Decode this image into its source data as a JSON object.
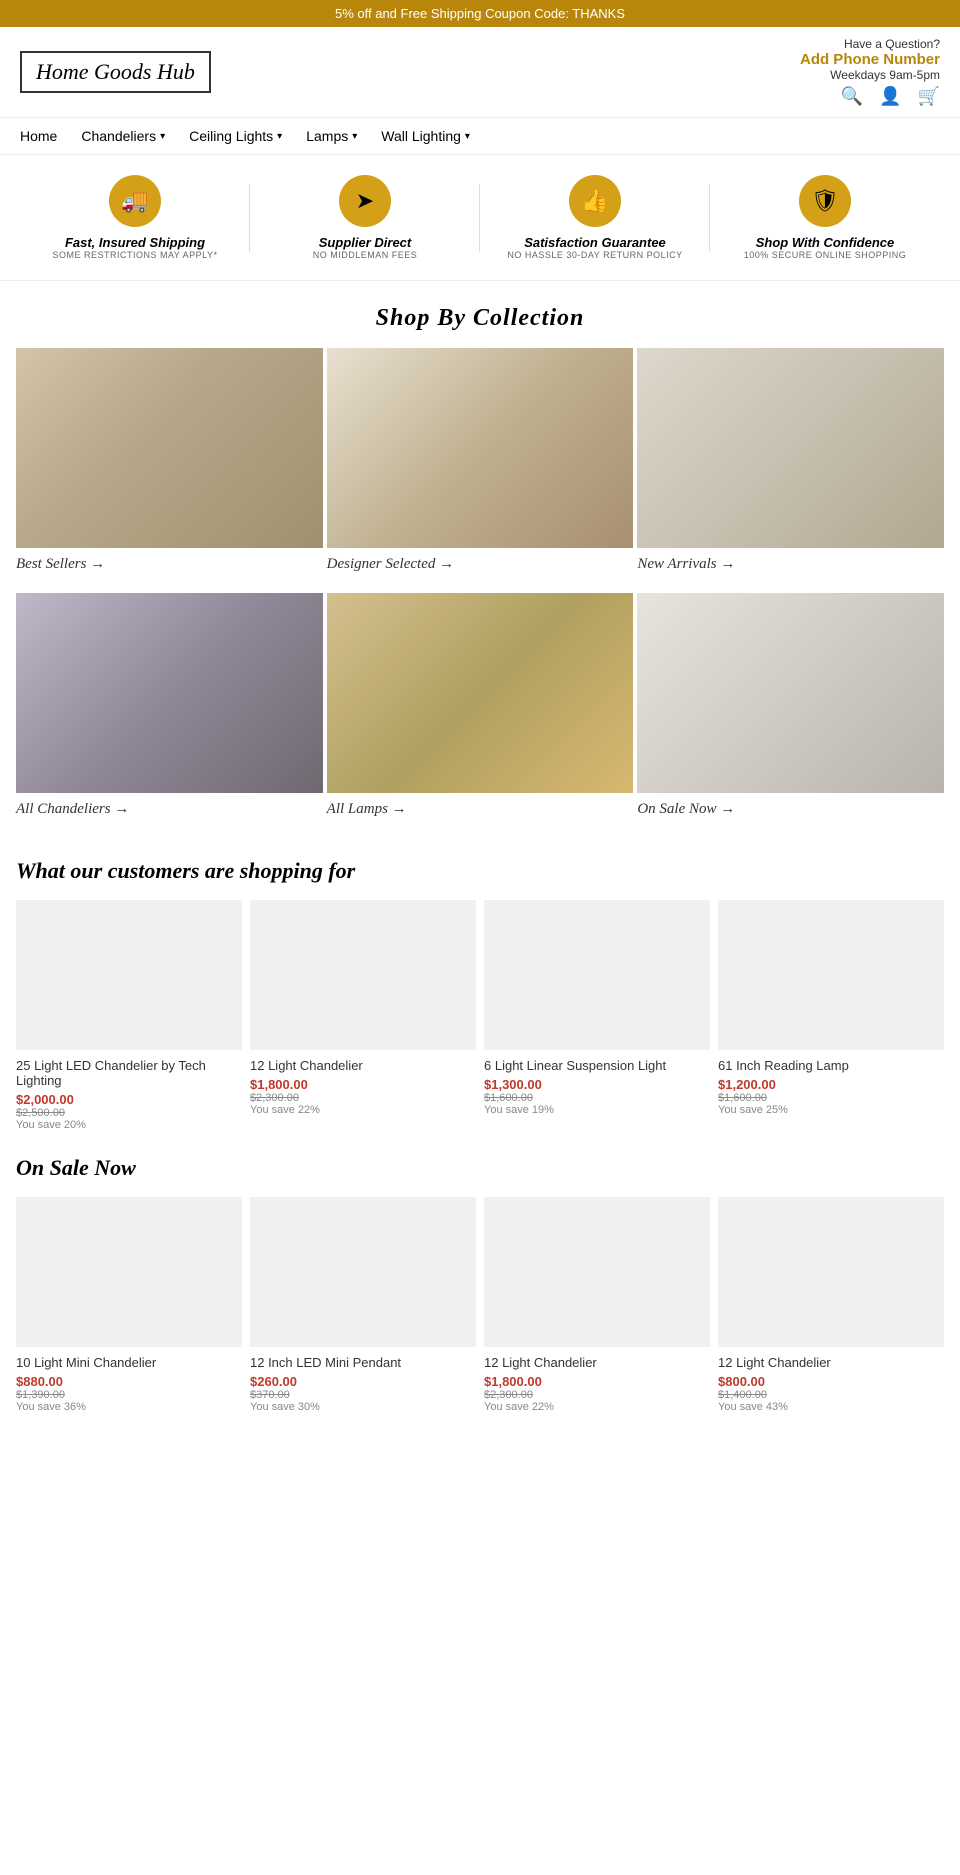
{
  "banner": {
    "text": "5% off and Free Shipping Coupon Code: THANKS"
  },
  "header": {
    "logo": "Home Goods Hub",
    "question_text": "Have a Question?",
    "phone_link": "Add Phone Number",
    "hours": "Weekdays 9am-5pm"
  },
  "nav": {
    "items": [
      {
        "label": "Home",
        "has_dropdown": false
      },
      {
        "label": "Chandeliers",
        "has_dropdown": true
      },
      {
        "label": "Ceiling Lights",
        "has_dropdown": true
      },
      {
        "label": "Lamps",
        "has_dropdown": true
      },
      {
        "label": "Wall Lighting",
        "has_dropdown": true
      }
    ]
  },
  "features": [
    {
      "icon": "🚚",
      "title": "Fast, Insured Shipping",
      "sub": "SOME RESTRICTIONS MAY APPLY*"
    },
    {
      "icon": "➤",
      "title": "Supplier Direct",
      "sub": "NO MIDDLEMAN FEES"
    },
    {
      "icon": "👍",
      "title": "Satisfaction Guarantee",
      "sub": "NO HASSLE 30-DAY RETURN POLICY"
    },
    {
      "icon": "🛡",
      "title": "Shop With Confidence",
      "sub": "100% SECURE ONLINE SHOPPING"
    }
  ],
  "collection": {
    "title": "Shop By Collection",
    "items": [
      {
        "label": "Best Sellers →",
        "img_class": "img-living"
      },
      {
        "label": "Designer Selected →",
        "img_class": "img-kitchen"
      },
      {
        "label": "New Arrivals →",
        "img_class": "img-dining"
      },
      {
        "label": "All Chandeliers →",
        "img_class": "img-chandelier-bedroom"
      },
      {
        "label": "All Lamps →",
        "img_class": "img-lamps"
      },
      {
        "label": "On Sale Now →",
        "img_class": "img-sale"
      }
    ]
  },
  "shopping_section": {
    "title": "What our customers are shopping for",
    "products": [
      {
        "name": "25 Light LED Chandelier by Tech Lighting",
        "price": "$2,000.00",
        "original": "$2,500.00",
        "savings": "You save 20%"
      },
      {
        "name": "12 Light Chandelier",
        "price": "$1,800.00",
        "original": "$2,300.00",
        "savings": "You save 22%"
      },
      {
        "name": "6 Light Linear Suspension Light",
        "price": "$1,300.00",
        "original": "$1,600.00",
        "savings": "You save 19%"
      },
      {
        "name": "61 Inch Reading Lamp",
        "price": "$1,200.00",
        "original": "$1,600.00",
        "savings": "You save 25%"
      }
    ]
  },
  "on_sale_section": {
    "title": "On Sale Now",
    "products": [
      {
        "name": "10 Light Mini Chandelier",
        "price": "$880.00",
        "original": "$1,390.00",
        "savings": "You save 36%"
      },
      {
        "name": "12 Inch LED Mini Pendant",
        "price": "$260.00",
        "original": "$370.00",
        "savings": "You save 30%"
      },
      {
        "name": "12 Light Chandelier",
        "price": "$1,800.00",
        "original": "$2,300.00",
        "savings": "You save 22%"
      },
      {
        "name": "12 Light Chandelier",
        "price": "$800.00",
        "original": "$1,400.00",
        "savings": "You save 43%"
      }
    ]
  }
}
